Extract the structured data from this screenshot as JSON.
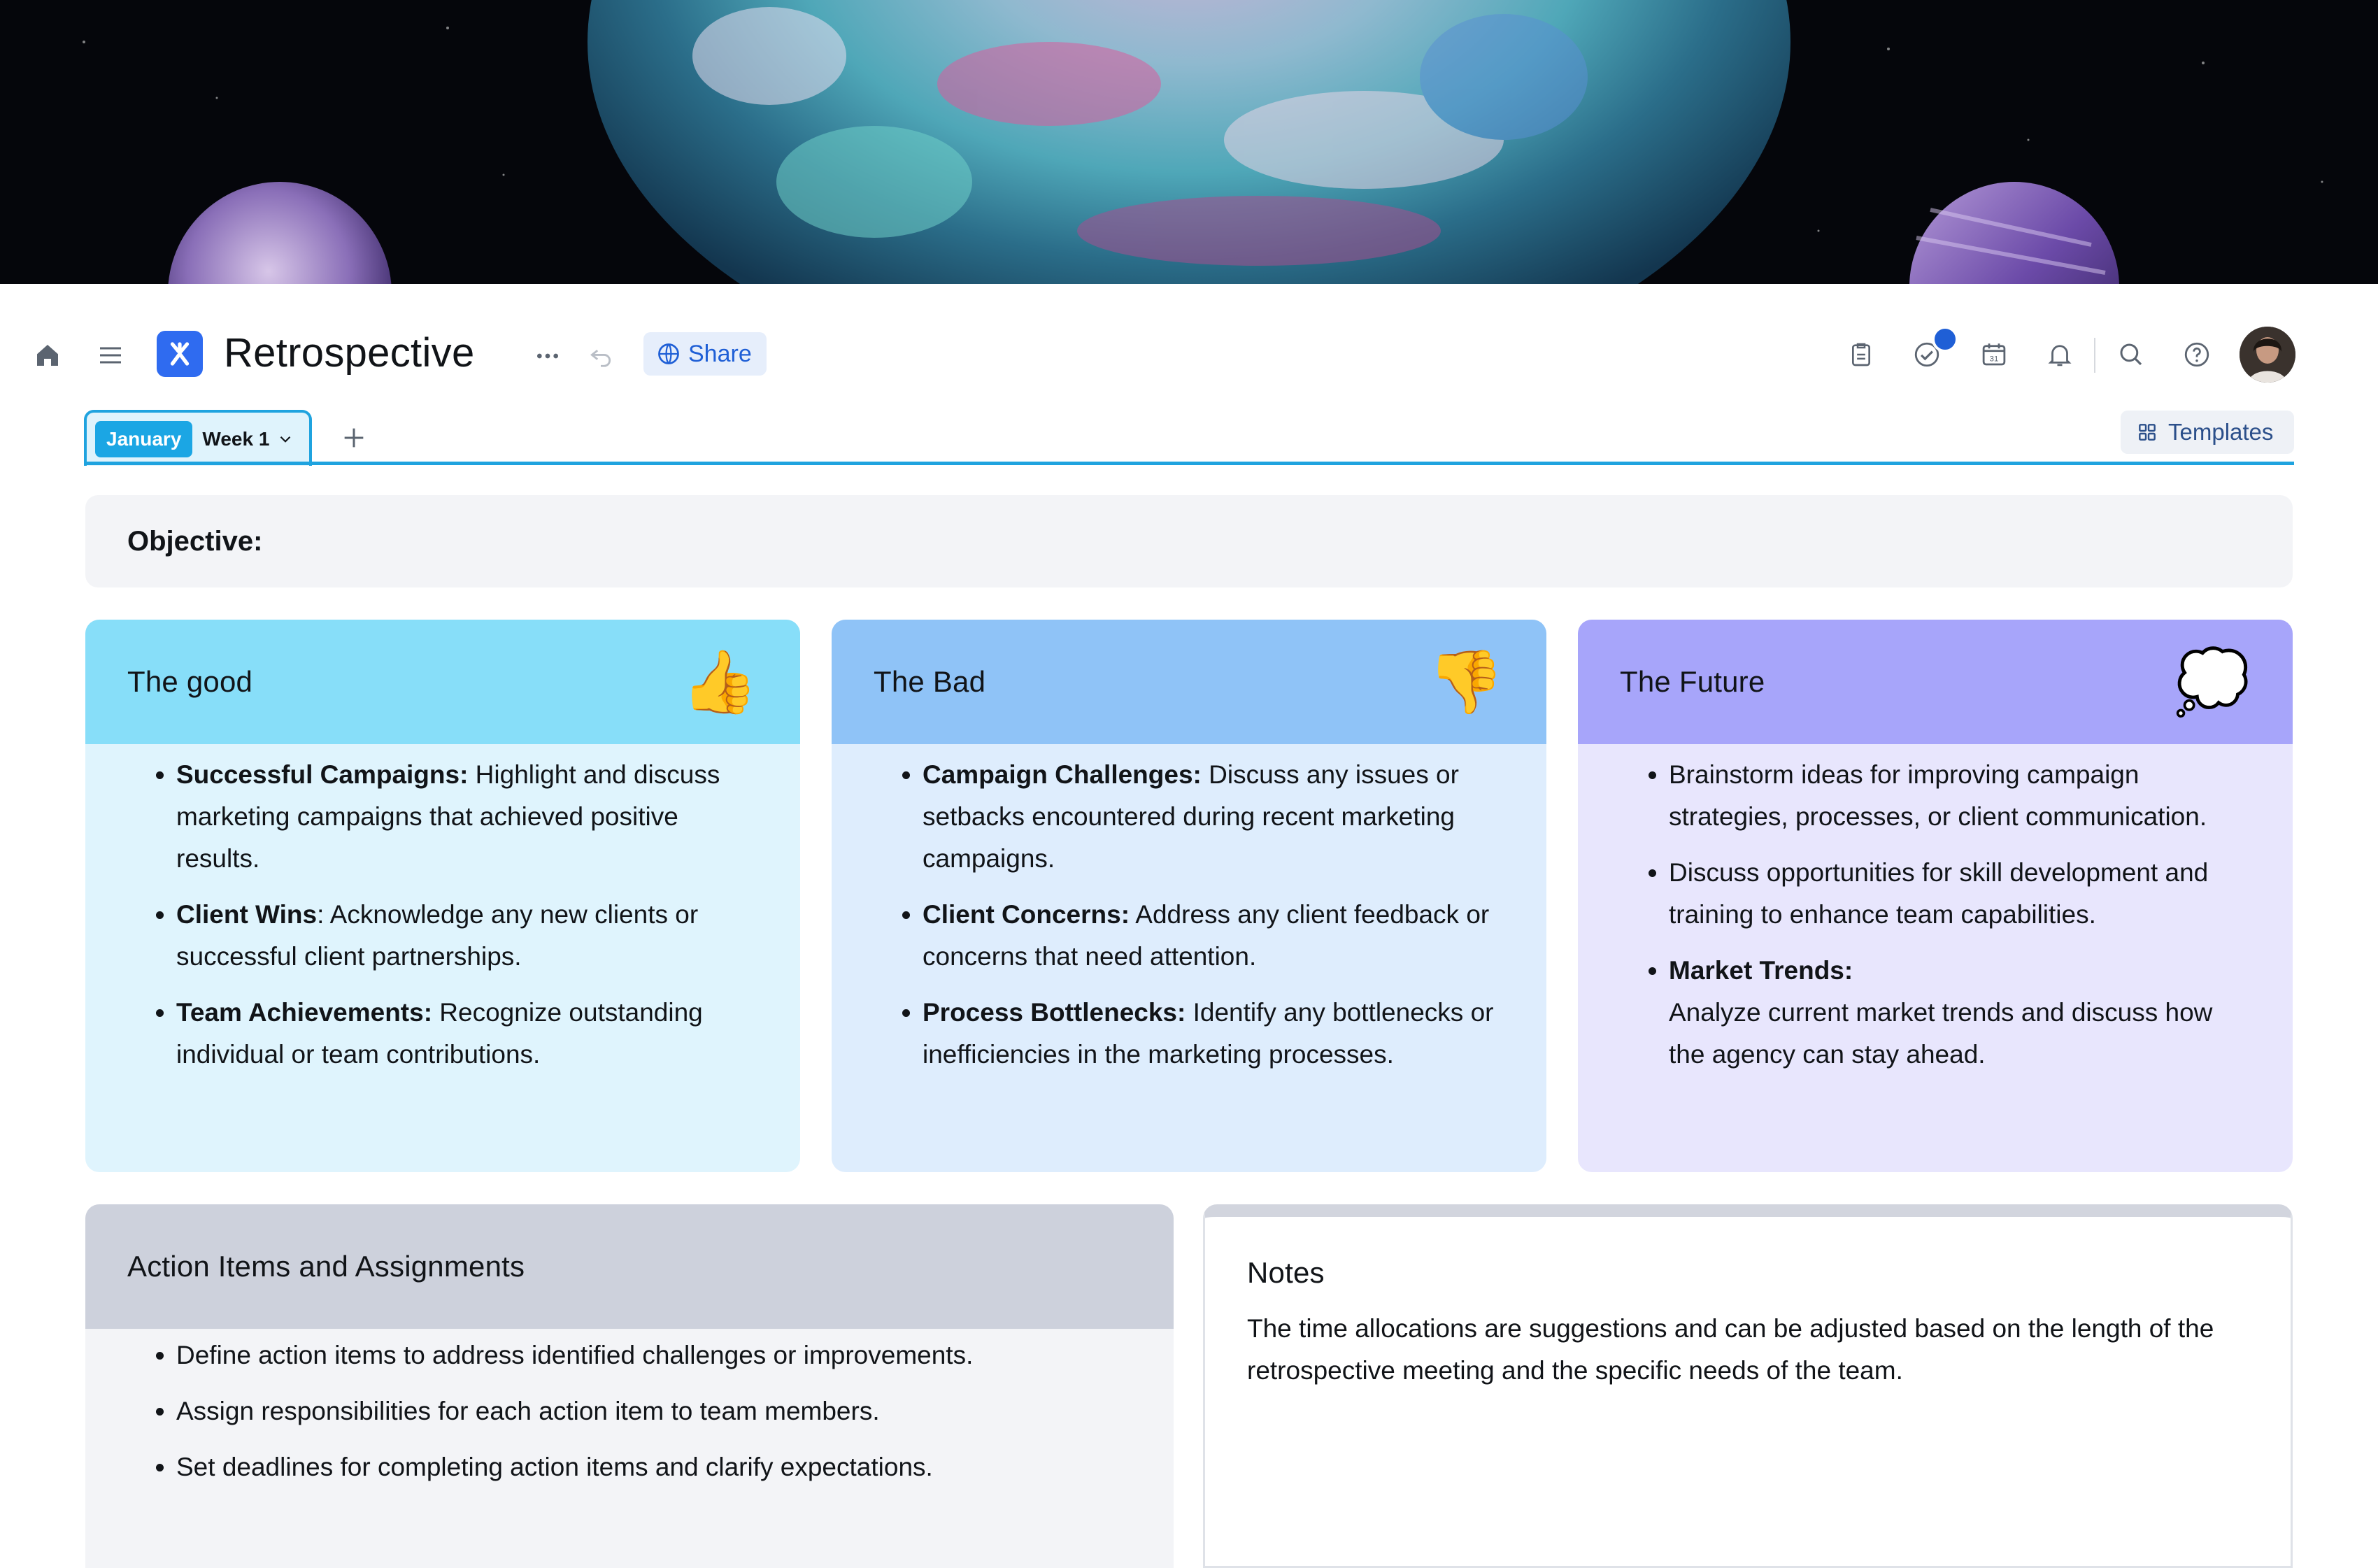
{
  "header": {
    "title": "Retrospective",
    "share_label": "Share"
  },
  "tabs": {
    "month_label": "January",
    "week_label": "Week 1",
    "templates_label": "Templates"
  },
  "objective": {
    "label": "Objective:"
  },
  "cards": {
    "good": {
      "title": "The good",
      "icon": "👍",
      "items": [
        {
          "bold": "Successful Campaigns:",
          "text": " Highlight and discuss marketing campaigns that achieved positive results."
        },
        {
          "bold": "Client Wins",
          "text": ": Acknowledge any new clients or successful client partnerships."
        },
        {
          "bold": "Team Achievements:",
          "text": " Recognize outstanding individual or team contributions."
        }
      ]
    },
    "bad": {
      "title": "The Bad",
      "icon": "👎",
      "items": [
        {
          "bold": "Campaign Challenges:",
          "text": " Discuss any issues or setbacks encountered during recent marketing campaigns."
        },
        {
          "bold": "Client Concerns:",
          "text": " Address any client feedback or concerns that need attention."
        },
        {
          "bold": "Process Bottlenecks:",
          "text": " Identify any bottlenecks or inefficiencies in the marketing processes."
        }
      ]
    },
    "future": {
      "title": "The Future",
      "icon": "💭",
      "items": [
        {
          "bold": "",
          "text": "Brainstorm ideas for improving campaign strategies, processes, or client communication."
        },
        {
          "bold": "",
          "text": "Discuss opportunities for skill development and training to enhance team capabilities."
        },
        {
          "bold": "Market Trends:",
          "text": "Analyze current market trends and discuss how the agency can stay ahead."
        }
      ]
    }
  },
  "action": {
    "title": "Action Items and Assignments",
    "items": [
      "Define action items to address identified challenges or improvements.",
      "Assign responsibilities for each action item to team members.",
      "Set deadlines for completing action items and clarify expectations."
    ]
  },
  "notes": {
    "title": "Notes",
    "text": "The time allocations are suggestions and can be adjusted based on the length of the retrospective meeting and the specific needs of the team."
  },
  "colors": {
    "accent": "#1fa3df",
    "brand": "#2f6bf0",
    "good_head": "#87def9",
    "bad_head": "#8fc3f7",
    "future_head": "#a7a5fa"
  }
}
